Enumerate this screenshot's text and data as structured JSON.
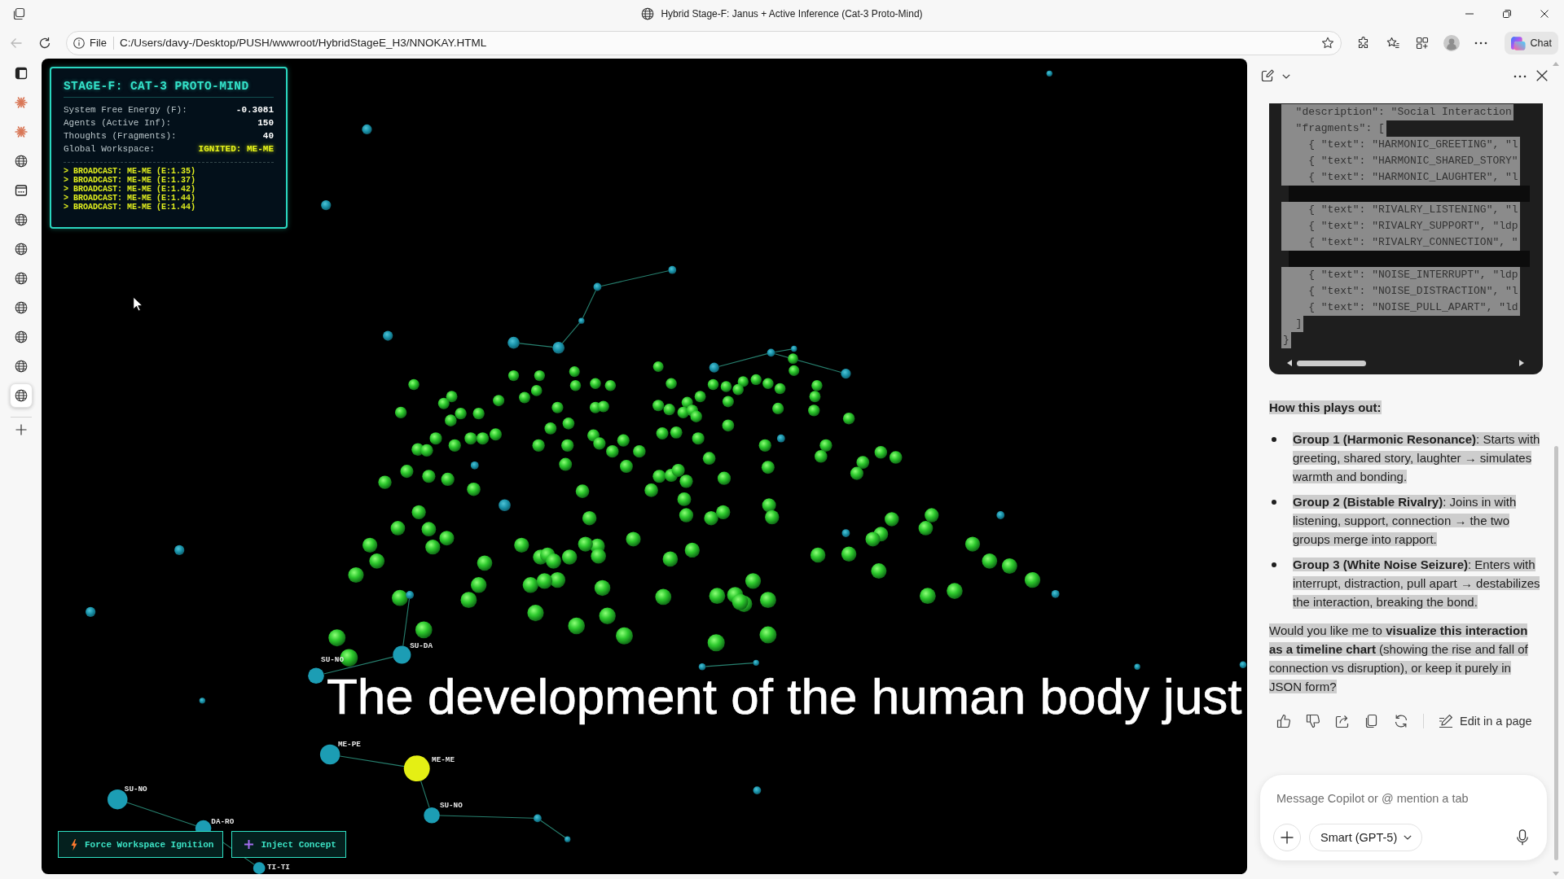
{
  "window": {
    "title": "Hybrid Stage-F: Janus + Active Inference (Cat-3 Proto-Mind)"
  },
  "toolbar": {
    "back": {
      "disabled": true
    },
    "address": {
      "scheme": "File",
      "url": "C:/Users/davy-/Desktop/PUSH/wwwroot/HybridStageE_H3/NNOKAY.HTML"
    },
    "chat_button": "Chat"
  },
  "vertical_tabs": [
    {
      "kind": "spark",
      "selected": false
    },
    {
      "kind": "spark",
      "selected": false
    },
    {
      "kind": "globe",
      "selected": false
    },
    {
      "kind": "document",
      "selected": false
    },
    {
      "kind": "globe",
      "selected": false
    },
    {
      "kind": "globe",
      "selected": false
    },
    {
      "kind": "globe",
      "selected": false
    },
    {
      "kind": "globe",
      "selected": false
    },
    {
      "kind": "globe",
      "selected": false
    },
    {
      "kind": "globe",
      "selected": false
    },
    {
      "kind": "globe",
      "selected": true
    }
  ],
  "hud": {
    "title": "STAGE-F: CAT-3 PROTO-MIND",
    "stats": [
      {
        "label": "System Free Energy (F):",
        "value": "-0.3081",
        "kind": "number"
      },
      {
        "label": "Agents (Active Inf):",
        "value": "150",
        "kind": "number"
      },
      {
        "label": "Thoughts (Fragments):",
        "value": "40",
        "kind": "number"
      },
      {
        "label": "Global Workspace:",
        "value": "IGNITED: ME-ME",
        "kind": "status"
      }
    ],
    "log": [
      "> BROADCAST: ME-ME (E:1.35)",
      "> BROADCAST: ME-ME (E:1.37)",
      "> BROADCAST: ME-ME (E:1.42)",
      "> BROADCAST: ME-ME (E:1.44)",
      "> BROADCAST: ME-ME (E:1.44)"
    ]
  },
  "graph": {
    "nodes": [
      {
        "label": "SU-DA",
        "color": "#1c9db4"
      },
      {
        "label": "SU-NO",
        "color": "#1c9db4"
      },
      {
        "label": "ME-PE",
        "color": "#1c9db4"
      },
      {
        "label": "ME-ME",
        "color": "#e4ef14"
      },
      {
        "label": "SU-NO",
        "color": "#1c9db4"
      },
      {
        "label": "SU-NO",
        "color": "#1c9db4"
      },
      {
        "label": "DA-RO",
        "color": "#1c9db4"
      },
      {
        "label": "TI-TI",
        "color": "#1c9db4"
      }
    ]
  },
  "caption": "The development of the human body just",
  "controls": [
    {
      "label": "Force Workspace Ignition",
      "kind": "bolt"
    },
    {
      "label": "Inject Concept",
      "kind": "plus"
    }
  ],
  "copilot": {
    "code": [
      [
        "  \"description\": \"Social Interaction",
        "  \"fragments\": [",
        "    { \"text\": \"HARMONIC_GREETING\", \"l",
        "    { \"text\": \"HARMONIC_SHARED_STORY\"",
        "    { \"text\": \"HARMONIC_LAUGHTER\", \"l"
      ],
      [
        "    { \"text\": \"RIVALRY_LISTENING\", \"l",
        "    { \"text\": \"RIVALRY_SUPPORT\", \"ldp",
        "    { \"text\": \"RIVALRY_CONNECTION\", \""
      ],
      [
        "    { \"text\": \"NOISE_INTERRUPT\", \"ldp",
        "    { \"text\": \"NOISE_DISTRACTION\", \"l",
        "    { \"text\": \"NOISE_PULL_APART\", \"ld",
        "  ]",
        "}"
      ]
    ],
    "heading": "How this plays out:",
    "bullets": [
      "**Group 1 (Harmonic Resonance)**: Starts with greeting, shared story, laughter → simulates warmth and bonding.",
      "**Group 2 (Bistable Rivalry)**: Joins in with listening, support, connection → the two groups merge into rapport.",
      "**Group 3 (White Noise Seizure)**: Enters with interrupt, distraction, pull apart → destabilizes the interaction, breaking the bond."
    ],
    "closing": "Would you like me to **visualize this interaction as a timeline chart** (showing the rise and fall of connection vs disruption), or keep it purely in JSON form?",
    "edit_button": "Edit in a page",
    "message": {
      "placeholder": "Message Copilot or @ mention a tab"
    },
    "model_button": "Smart (GPT-5)"
  }
}
